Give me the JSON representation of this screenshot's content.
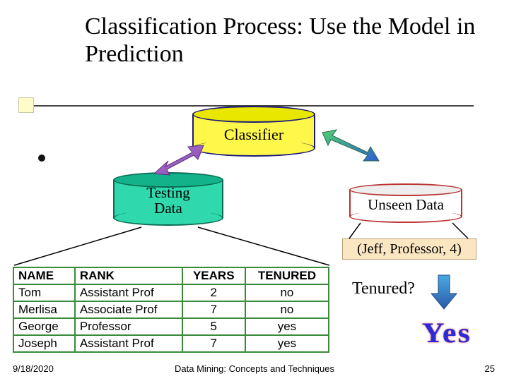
{
  "title": "Classification Process: Use the Model in Prediction",
  "nodes": {
    "classifier": "Classifier",
    "testing": "Testing\nData",
    "unseen": "Unseen Data"
  },
  "tuple": "(Jeff, Professor, 4)",
  "question": "Tenured?",
  "answer": "Yes",
  "table": {
    "headers": [
      "NAME",
      "RANK",
      "YEARS",
      "TENURED"
    ],
    "rows": [
      [
        "Tom",
        "Assistant Prof",
        "2",
        "no"
      ],
      [
        "Merlisa",
        "Associate Prof",
        "7",
        "no"
      ],
      [
        "George",
        "Professor",
        "5",
        "yes"
      ],
      [
        "Joseph",
        "Assistant Prof",
        "7",
        "yes"
      ]
    ]
  },
  "footer": {
    "date": "9/18/2020",
    "mid": "Data Mining: Concepts and Techniques",
    "page": "25"
  },
  "colors": {
    "classifier_fill": "#fff84a",
    "testing_fill": "#2fd9ad",
    "unseen_stroke": "#b33",
    "answer_color": "#2a2ad8"
  }
}
